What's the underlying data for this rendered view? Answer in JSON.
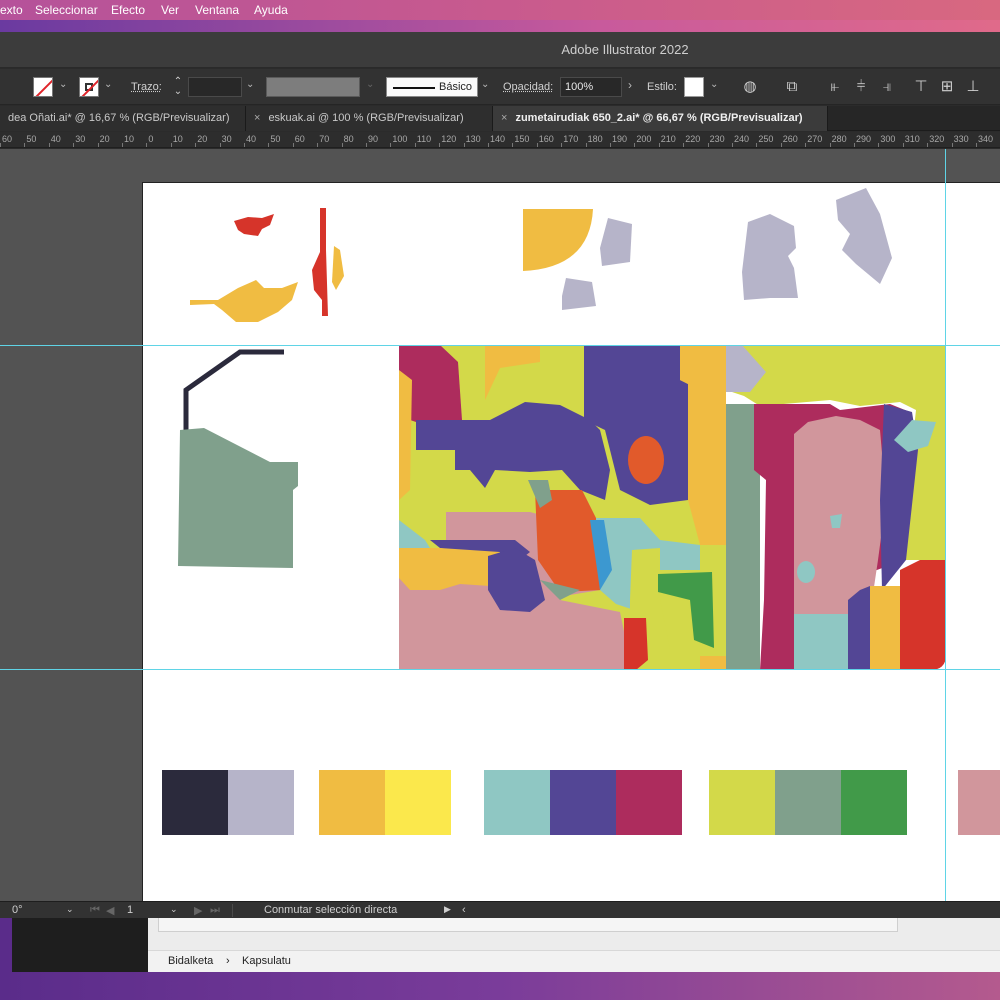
{
  "menubar": {
    "items": [
      "exto",
      "Seleccionar",
      "Efecto",
      "Ver",
      "Ventana",
      "Ayuda"
    ]
  },
  "titlebar": {
    "title": "Adobe Illustrator 2022"
  },
  "control": {
    "trazo_label": "Trazo:",
    "stroke_style": "Básico",
    "opacity_label": "Opacidad:",
    "opacity_value": "100%",
    "style_label": "Estilo:"
  },
  "tabs": [
    {
      "label": "dea Oñati.ai* @ 16,67 % (RGB/Previsualizar)",
      "active": false
    },
    {
      "label": "eskuak.ai @ 100 % (RGB/Previsualizar)",
      "active": false
    },
    {
      "label": "zumetairudiak 650_2.ai* @ 66,67 % (RGB/Previsualizar)",
      "active": true
    }
  ],
  "tab_close": "×",
  "ruler": {
    "ticks": [
      "60",
      "50",
      "40",
      "30",
      "20",
      "10",
      "0",
      "10",
      "20",
      "30",
      "40",
      "50",
      "60",
      "70",
      "80",
      "90",
      "100",
      "110",
      "120",
      "130",
      "140",
      "150",
      "160",
      "170",
      "180",
      "190",
      "200",
      "210",
      "220",
      "230",
      "240",
      "250",
      "260",
      "270",
      "280",
      "290",
      "300",
      "310",
      "320",
      "330",
      "340"
    ]
  },
  "palette": [
    [
      "#2b2a3c",
      "#b6b4c9"
    ],
    [
      "#f0bc42",
      "#fbe84c"
    ],
    [
      "#8fc7c3",
      "#534695",
      "#ad2c5d"
    ],
    [
      "#d3d949",
      "#80a08c",
      "#419a49"
    ],
    [
      "#d1969c"
    ]
  ],
  "status": {
    "rotation": "0°",
    "artboard_number": "1",
    "tool_hint": "Conmutar selección directa"
  },
  "finder_path": {
    "items": [
      "Bidalketa",
      "Kapsulatu"
    ],
    "separator": "›"
  }
}
